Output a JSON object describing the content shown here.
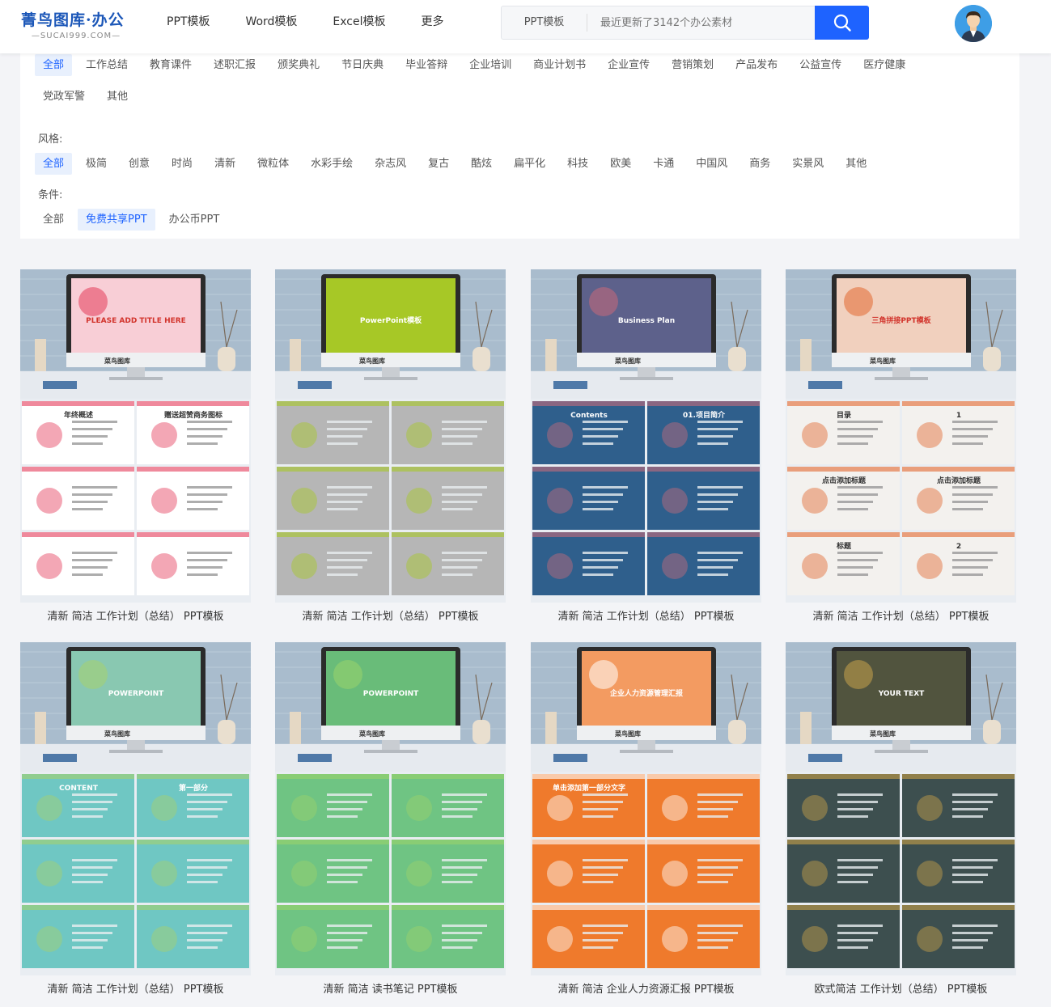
{
  "header": {
    "logo_main": "菁鸟图库·办公",
    "logo_sub": "—SUCAI999.COM—",
    "nav": [
      "PPT模板",
      "Word模板",
      "Excel模板",
      "更多"
    ],
    "search": {
      "category": "PPT模板",
      "placeholder": "最近更新了3142个办公素材"
    }
  },
  "filters": {
    "categories": [
      "全部",
      "工作总结",
      "教育课件",
      "述职汇报",
      "颁奖典礼",
      "节日庆典",
      "毕业答辩",
      "企业培训",
      "商业计划书",
      "企业宣传",
      "营销策划",
      "产品发布",
      "公益宣传",
      "医疗健康",
      "党政军警",
      "其他"
    ],
    "style_label": "风格:",
    "styles": [
      "全部",
      "极简",
      "创意",
      "时尚",
      "清新",
      "微粒体",
      "水彩手绘",
      "杂志风",
      "复古",
      "酷炫",
      "扁平化",
      "科技",
      "欧美",
      "卡通",
      "中国风",
      "商务",
      "实景风",
      "其他"
    ],
    "condition_label": "条件:",
    "conditions": [
      "全部",
      "免费共享PPT",
      "办公币PPT"
    ],
    "active": {
      "category": 0,
      "style": 0,
      "condition": 1
    }
  },
  "cards": [
    {
      "caption": "清新 简洁 工作计划（总结） PPT模板",
      "screen_text": "PLEASE ADD TITLE HERE",
      "brand": "菜鸟图库",
      "slide_texts": [
        "年终概述",
        "赠送超赞商务图标"
      ],
      "theme": "#ffffff",
      "accent": "#e43b5a",
      "screen_bg": "#ffffff"
    },
    {
      "caption": "清新 简洁 工作计划（总结） PPT模板",
      "screen_text": "PowerPoint模板",
      "brand": "菜鸟图库",
      "slide_texts": [],
      "theme": "#b6b6b6",
      "accent": "#a7c826",
      "screen_bg": "#a7c826"
    },
    {
      "caption": "清新 简洁 工作计划（总结） PPT模板",
      "screen_text": "Business Plan",
      "brand": "菜鸟图库",
      "slide_texts": [
        "Contents",
        "01.项目简介"
      ],
      "theme": "#2f5f8c",
      "accent": "#c86a7a",
      "screen_bg": "#3a5e90"
    },
    {
      "caption": "清新 简洁 工作计划（总结） PPT模板",
      "screen_text": "三角拼接PPT模板",
      "brand": "菜鸟图库",
      "slide_texts": [
        "目录",
        "1",
        "点击添加标题",
        "点击添加标题",
        "标题",
        "2"
      ],
      "theme": "#f3f1ee",
      "accent": "#e2682f",
      "screen_bg": "#f6f3ee"
    },
    {
      "caption": "清新 简洁 工作计划（总结） PPT模板",
      "screen_text": "POWERPOINT",
      "brand": "菜鸟图库",
      "slide_texts": [
        "CONTENT",
        "第一部分"
      ],
      "theme": "#6fc7c3",
      "accent": "#a6d16d",
      "screen_bg": "#7fc6c8"
    },
    {
      "caption": "清新 简洁 读书笔记 PPT模板",
      "screen_text": "POWERPOINT",
      "brand": "菜鸟图库",
      "slide_texts": [],
      "theme": "#6fc483",
      "accent": "#9bd36b",
      "screen_bg": "#58b47e"
    },
    {
      "caption": "清新 简洁 企业人力资源汇报 PPT模板",
      "screen_text": "企业人力资源管理汇报",
      "brand": "菜鸟图库",
      "slide_texts": [
        "单击添加第一部分文字"
      ],
      "theme": "#ef7a2c",
      "accent": "#ffffff",
      "screen_bg": "#ef7a2c"
    },
    {
      "caption": "欧式简洁 工作计划（总结） PPT模板",
      "screen_text": "YOUR TEXT",
      "brand": "菜鸟图库",
      "slide_texts": [],
      "theme": "#3d4f4f",
      "accent": "#c9a24a",
      "screen_bg": "#2a3a3a"
    }
  ]
}
